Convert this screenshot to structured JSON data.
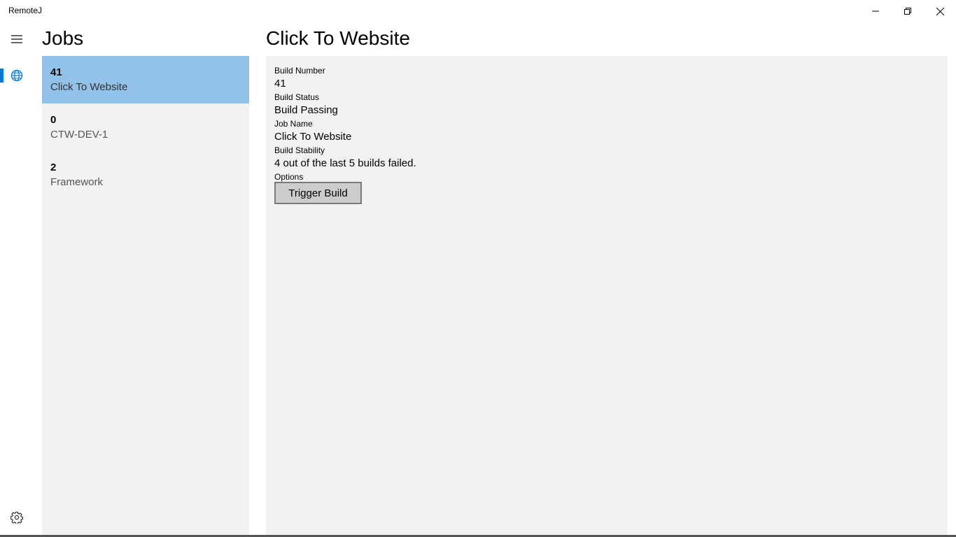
{
  "window": {
    "title": "RemoteJ",
    "minimize_icon": "minimize-icon",
    "restore_icon": "restore-icon",
    "close_icon": "close-icon"
  },
  "nav": {
    "menu_icon": "hamburger-icon",
    "jobs_icon": "globe-icon",
    "settings_icon": "gear-icon",
    "accent_color": "#0078d7"
  },
  "jobs": {
    "heading": "Jobs",
    "selected_color": "#92c1e9",
    "items": [
      {
        "number": "41",
        "name": "Click To Website"
      },
      {
        "number": "0",
        "name": "CTW-DEV-1"
      },
      {
        "number": "2",
        "name": "Framework"
      }
    ]
  },
  "detail": {
    "heading": "Click To Website",
    "build_number_label": "Build Number",
    "build_number": "41",
    "build_status_label": "Build Status",
    "build_status": "Build Passing",
    "job_name_label": "Job Name",
    "job_name": "Click To Website",
    "build_stability_label": "Build Stability",
    "build_stability": "4 out of the last 5 builds failed.",
    "options_label": "Options",
    "trigger_button": "Trigger Build"
  }
}
